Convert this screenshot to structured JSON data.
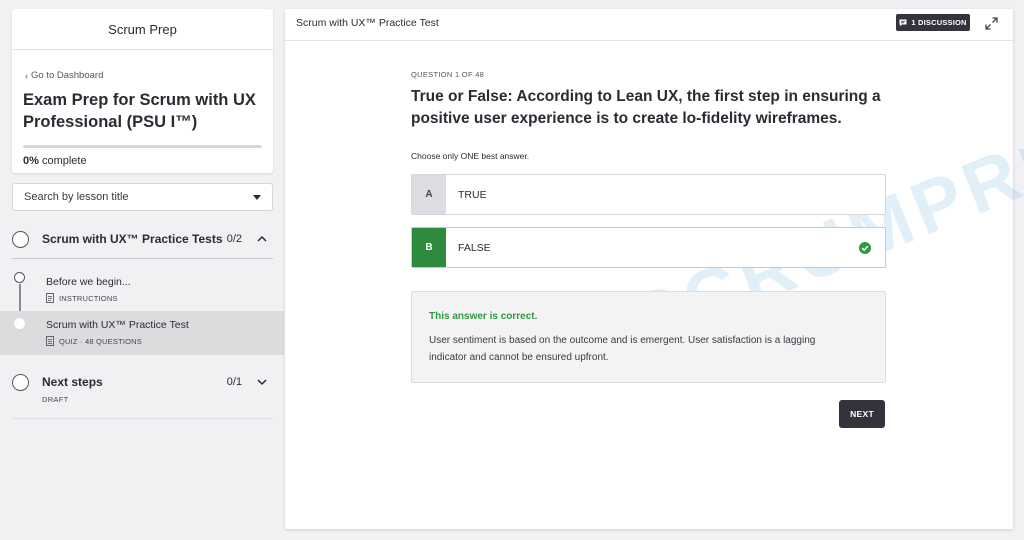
{
  "sidebar": {
    "school_name": "Scrum Prep",
    "back_link": "Go to Dashboard",
    "course_title": "Exam Prep for Scrum with UX Professional (PSU I™)",
    "progress": {
      "percent_label": "0%",
      "suffix": " complete",
      "value": 0
    },
    "search_placeholder": "Search by lesson title",
    "sections": [
      {
        "title": "Scrum with UX™ Practice Tests",
        "count": "0/2",
        "expanded": true,
        "lessons": [
          {
            "title": "Before we begin...",
            "meta": "INSTRUCTIONS",
            "active": false
          },
          {
            "title": "Scrum with UX™ Practice Test",
            "meta": "QUIZ · 48 QUESTIONS",
            "active": true
          }
        ]
      },
      {
        "title": "Next steps",
        "count": "0/1",
        "expanded": false,
        "subtitle": "DRAFT"
      }
    ]
  },
  "main": {
    "header_title": "Scrum with UX™ Practice Test",
    "discussion_label": "1 DISCUSSION",
    "watermark_text": "SCRUMPREP",
    "question": {
      "counter": "QUESTION 1 OF 48",
      "text": "True or False: According to Lean UX, the first step in ensuring a positive user experience is to create lo-fidelity wireframes.",
      "instruction": "Choose only ONE best answer."
    },
    "answers": [
      {
        "letter": "A",
        "text": "TRUE",
        "correct": false
      },
      {
        "letter": "B",
        "text": "FALSE",
        "correct": true
      }
    ],
    "feedback": {
      "title": "This answer is correct.",
      "body": "User sentiment is based on the outcome and is emergent. User satisfaction is a lagging indicator and cannot be ensured upfront."
    },
    "next_label": "NEXT"
  },
  "colors": {
    "correct_green": "#2e8b3e",
    "feedback_green": "#2e9a43",
    "dark_button": "#33333c",
    "watermark_blue": "#8ec5ea"
  }
}
